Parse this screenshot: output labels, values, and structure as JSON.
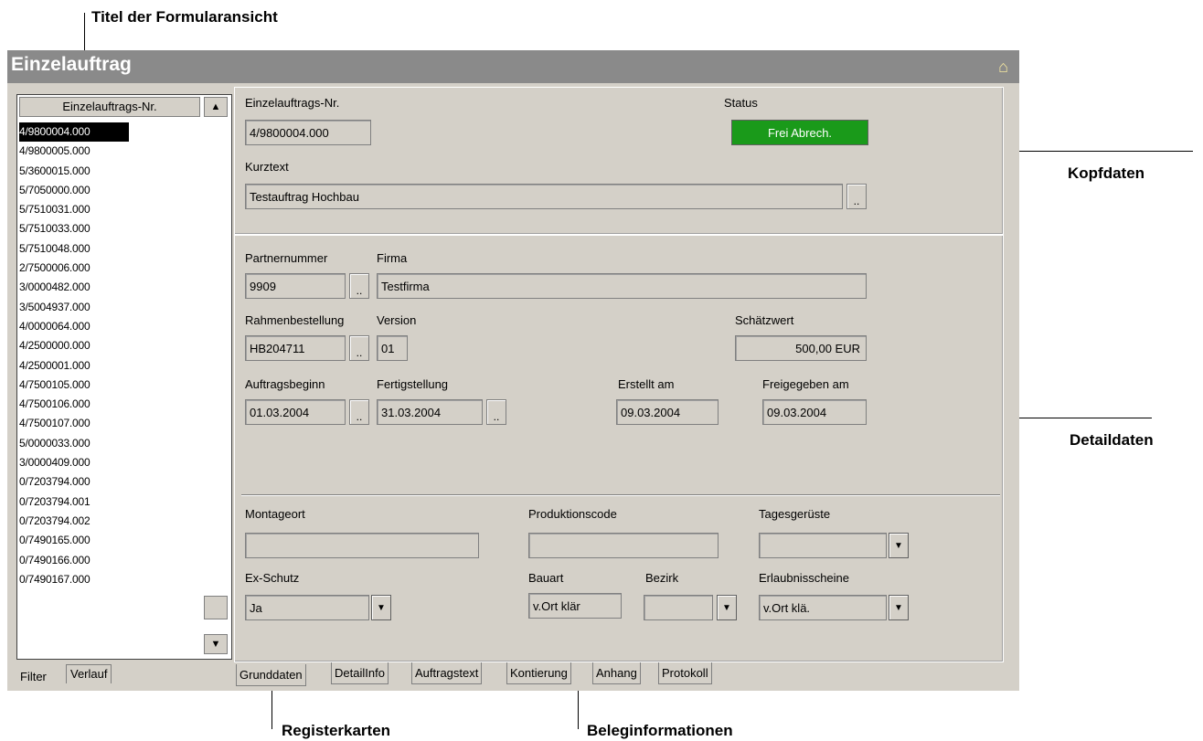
{
  "annotations": {
    "title_view": "Titel der Formularansicht",
    "kopfdaten": "Kopfdaten",
    "detaildaten": "Detaildaten",
    "registerkarten": "Registerkarten",
    "beleginformationen": "Beleginformationen"
  },
  "window": {
    "title": "Einzelauftrag",
    "icon": "door-icon"
  },
  "list": {
    "header": "Einzelauftrags-Nr.",
    "items": [
      "4/9800004.000",
      "4/9800005.000",
      "5/3600015.000",
      "5/7050000.000",
      "5/7510031.000",
      "5/7510033.000",
      "5/7510048.000",
      "2/7500006.000",
      "3/0000482.000",
      "3/5004937.000",
      "4/0000064.000",
      "4/2500000.000",
      "4/2500001.000",
      "4/7500105.000",
      "4/7500106.000",
      "4/7500107.000",
      "5/0000033.000",
      "3/0000409.000",
      "0/7203794.000",
      "0/7203794.001",
      "0/7203794.002",
      "0/7490165.000",
      "0/7490166.000",
      "0/7490167.000"
    ],
    "selected_index": 0,
    "tabs": [
      "Filter",
      "Verlauf"
    ]
  },
  "header": {
    "order_no_label": "Einzelauftrags-Nr.",
    "order_no_value": "4/9800004.000",
    "status_label": "Status",
    "status_value": "Frei Abrech.",
    "status_color": "#1a9a1a",
    "kurztext_label": "Kurztext",
    "kurztext_value": "Testauftrag Hochbau",
    "ellipsis": ".."
  },
  "detail": {
    "partnernummer_label": "Partnernummer",
    "partnernummer_value": "9909",
    "firma_label": "Firma",
    "firma_value": "Testfirma",
    "rahmen_label": "Rahmenbestellung",
    "rahmen_value": "HB204711",
    "version_label": "Version",
    "version_value": "01",
    "schaetz_label": "Schätzwert",
    "schaetz_value": "500,00 EUR",
    "beginn_label": "Auftragsbeginn",
    "beginn_value": "01.03.2004",
    "fertig_label": "Fertigstellung",
    "fertig_value": "31.03.2004",
    "erstellt_label": "Erstellt am",
    "erstellt_value": "09.03.2004",
    "freigegeben_label": "Freigegeben am",
    "freigegeben_value": "09.03.2004",
    "montageort_label": "Montageort",
    "montageort_value": "",
    "produktion_label": "Produktionscode",
    "produktion_value": "",
    "tages_label": "Tagesgerüste",
    "tages_value": "",
    "exschutz_label": "Ex-Schutz",
    "exschutz_value": "Ja",
    "bauart_label": "Bauart",
    "bauart_value": "v.Ort klär",
    "bezirk_label": "Bezirk",
    "bezirk_value": "",
    "erlaubnis_label": "Erlaubnisscheine",
    "erlaubnis_value": "v.Ort klä."
  },
  "tabs": [
    "Grunddaten",
    "DetailInfo",
    "Auftragstext",
    "Kontierung",
    "Anhang",
    "Protokoll"
  ]
}
